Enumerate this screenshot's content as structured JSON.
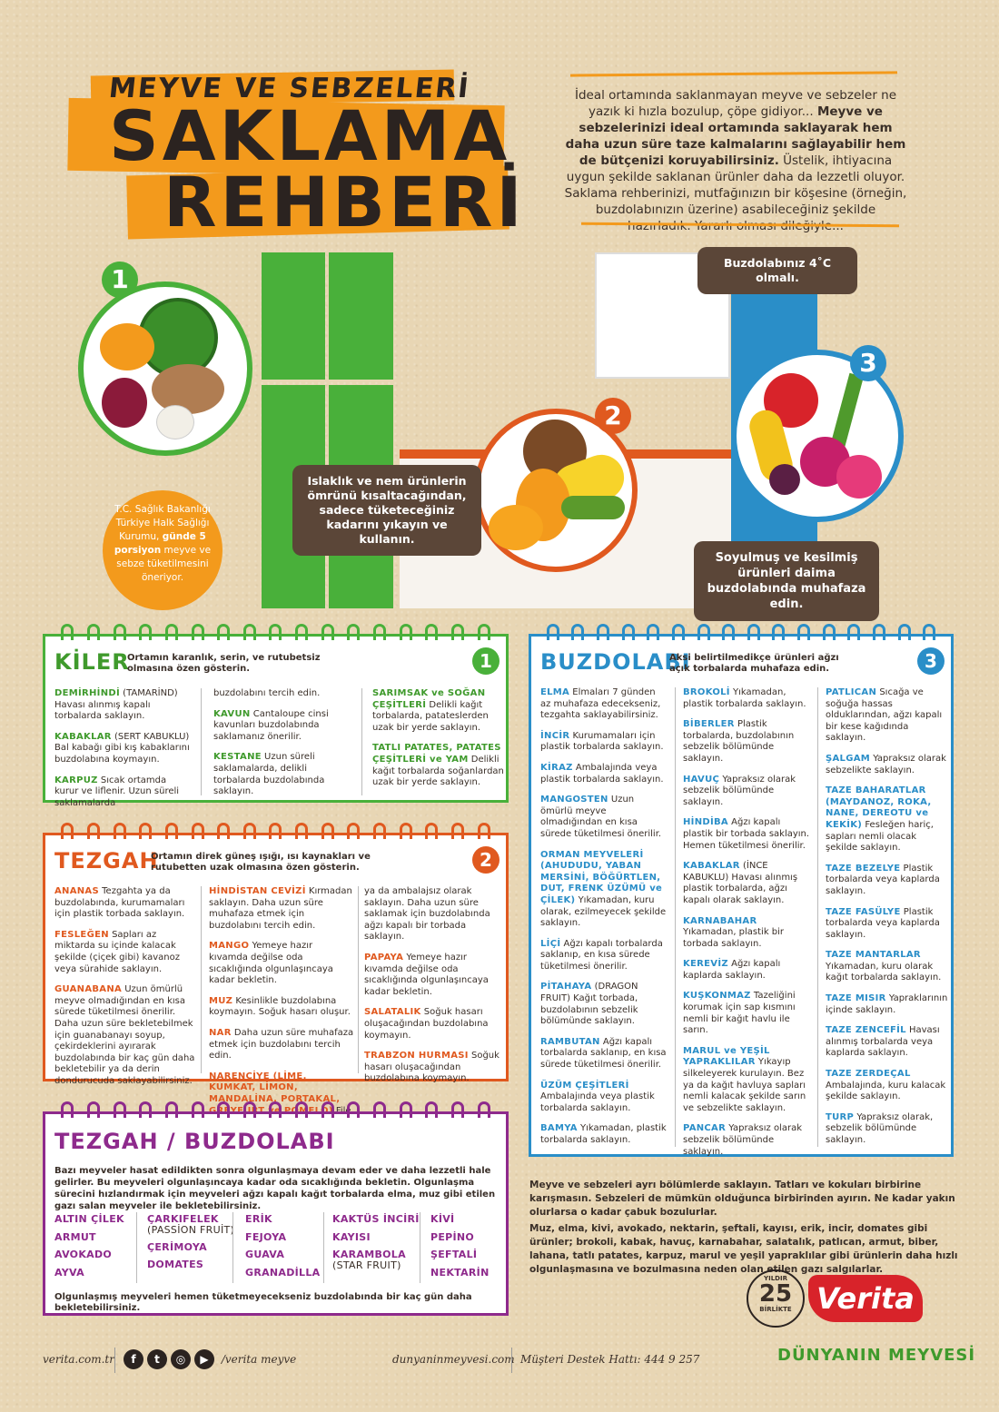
{
  "header": {
    "title_small": "MEYVE VE SEBZELERİ",
    "title_line1": "SAKLAMA",
    "title_line2": "REHBERİ",
    "intro_1": "İdeal ortamında saklanmayan meyve ve sebzeler ne yazık ki hızla bozulup, çöpe gidiyor...",
    "intro_bold": "Meyve ve sebzelerinizi ideal ortamında saklayarak hem daha uzun süre taze kalmalarını sağlayabilir hem de bütçenizi koruyabilirsiniz.",
    "intro_2": "Üstelik, ihtiyacına uygun şekilde saklanan ürünler daha da lezzetli oluyor. Saklama rehberinizi, mutfağınızın bir köşesine (örneğin, buzdolabınızın üzerine) asabileceğiniz şekilde hazırladık. Yararlı olması dileğiyle..."
  },
  "illustration": {
    "num1": "1",
    "num2": "2",
    "num3": "3",
    "fridge_temp": "Buzdolabınız 4˚C olmalı.",
    "wash_tip": "Islaklık ve nem ürünlerin ömrünü kısaltacağından, sadece tüketeceğiniz kadarını yıkayın ve kullanın.",
    "cut_tip": "Soyulmuş ve kesilmiş ürünleri daima buzdolabında muhafaza edin.",
    "health_1": "T.C. Sağlık Bakanlığı Türkiye Halk Sağlığı Kurumu,",
    "health_bold": "günde 5 porsiyon",
    "health_2": "meyve ve sebze tüketilmesini öneriyor."
  },
  "kiler": {
    "title": "KİLER",
    "subtitle": "Ortamın karanlık, serin, ve rutubetsiz olmasına özen gösterin.",
    "num": "1",
    "col1": [
      {
        "k": "DEMİRHİNDİ",
        "t": " (TAMARİND) Havası alınmış kapalı torbalarda saklayın."
      },
      {
        "k": "KABAKLAR",
        "t": " (SERT KABUKLU) Bal kabağı gibi kış kabaklarını buzdolabına koymayın."
      },
      {
        "k": "KARPUZ",
        "t": " Sıcak ortamda kurur ve liflenir. Uzun süreli saklamalarda"
      }
    ],
    "col2": [
      {
        "k": "",
        "t": "buzdolabını tercih edin."
      },
      {
        "k": "KAVUN",
        "t": " Cantaloupe cinsi kavunları buzdolabında saklamanız önerilir."
      },
      {
        "k": "KESTANE",
        "t": " Uzun süreli saklamalarda, delikli torbalarda buzdolabında saklayın."
      }
    ],
    "col3": [
      {
        "k": "SARIMSAK ve SOĞAN ÇEŞİTLERİ",
        "t": " Delikli kağıt torbalarda, patateslerden uzak bir yerde saklayın."
      },
      {
        "k": "TATLI PATATES, PATATES ÇEŞİTLERİ ve YAM",
        "t": " Delikli kağıt torbalarda soğanlardan uzak bir yerde saklayın."
      }
    ]
  },
  "tezgah": {
    "title": "TEZGAH",
    "subtitle": "Ortamın direk güneş ışığı, ısı kaynakları ve rutubetten uzak olmasına özen gösterin.",
    "num": "2",
    "col1": [
      {
        "k": "ANANAS",
        "t": " Tezgahta ya da buzdolabında, kurumamaları için plastik torbada saklayın."
      },
      {
        "k": "FESLEĞEN",
        "t": " Sapları az miktarda su içinde kalacak şekilde (çiçek gibi) kavanoz veya sürahide saklayın."
      },
      {
        "k": "GUANABANA",
        "t": " Uzun ömürlü meyve olmadığından en kısa sürede tüketilmesi önerilir. Daha uzun süre bekletebilmek için guanabanayı soyup, çekirdeklerini ayırarak buzdolabında bir kaç gün daha bekletebilir ya da derin dondurucuda saklayabilirsiniz."
      }
    ],
    "col2": [
      {
        "k": "HİNDİSTAN CEVİZİ",
        "t": " Kırmadan saklayın. Daha uzun süre muhafaza etmek için buzdolabını tercih edin."
      },
      {
        "k": "MANGO",
        "t": " Yemeye hazır kıvamda değilse oda sıcaklığında olgunlaşıncaya kadar bekletin."
      },
      {
        "k": "MUZ",
        "t": " Kesinlikle buzdolabına koymayın. Soğuk hasarı oluşur."
      },
      {
        "k": "NAR",
        "t": " Daha uzun süre muhafaza etmek için buzdolabını tercih edin."
      },
      {
        "k": "NARENCİYE (LİME, KUMKAT, LİMON, MANDALİNA, PORTAKAL, GREYFURT ve POMELO)",
        "t": " File içinde"
      }
    ],
    "col3": [
      {
        "k": "",
        "t": "ya da ambalajsız olarak saklayın. Daha uzun süre saklamak için buzdolabında ağzı kapalı bir torbada saklayın."
      },
      {
        "k": "PAPAYA",
        "t": " Yemeye hazır kıvamda değilse oda sıcaklığında olgunlaşıncaya kadar bekletin."
      },
      {
        "k": "SALATALIK",
        "t": " Soğuk hasarı oluşacağından buzdolabına koymayın."
      },
      {
        "k": "TRABZON HURMASI",
        "t": " Soğuk hasarı oluşacağından buzdolabına koymayın."
      }
    ]
  },
  "buzdolabi": {
    "title": "BUZDOLABI",
    "subtitle": "Aksi belirtilmedikçe ürünleri ağzı açık torbalarda muhafaza edin.",
    "num": "3",
    "col1": [
      {
        "k": "ELMA",
        "t": " Elmaları 7 günden az muhafaza edecekseniz, tezgahta saklayabilirsiniz."
      },
      {
        "k": "İNCİR",
        "t": " Kurumamaları için plastik torbalarda saklayın."
      },
      {
        "k": "KİRAZ",
        "t": " Ambalajında veya plastik torbalarda saklayın."
      },
      {
        "k": "MANGOSTEN",
        "t": " Uzun ömürlü meyve olmadığından en kısa sürede tüketilmesi önerilir."
      },
      {
        "k": "ORMAN MEYVELERİ (AHUDUDU, YABAN MERSİNİ, BÖĞÜRTLEN, DUT, FRENK ÜZÜMÜ ve ÇİLEK)",
        "t": " Yıkamadan, kuru olarak, ezilmeyecek şekilde saklayın."
      },
      {
        "k": "LİÇİ",
        "t": " Ağzı kapalı torbalarda saklanıp, en kısa sürede tüketilmesi önerilir."
      },
      {
        "k": "PİTAHAYA",
        "t": " (DRAGON FRUIT) Kağıt torbada, buzdolabının sebzelik bölümünde saklayın."
      },
      {
        "k": "RAMBUTAN",
        "t": " Ağzı kapalı torbalarda saklanıp, en kısa sürede tüketilmesi önerilir."
      },
      {
        "k": "ÜZÜM ÇEŞİTLERİ",
        "t": " Ambalajında veya plastik torbalarda saklayın."
      },
      {
        "k": "BAMYA",
        "t": " Yıkamadan, plastik torbalarda saklayın."
      }
    ],
    "col2": [
      {
        "k": "BROKOLİ",
        "t": " Yıkamadan, plastik torbalarda saklayın."
      },
      {
        "k": "BİBERLER",
        "t": " Plastik torbalarda, buzdolabının sebzelik bölümünde saklayın."
      },
      {
        "k": "HAVUÇ",
        "t": " Yapraksız olarak sebzelik bölümünde saklayın."
      },
      {
        "k": "HİNDİBA",
        "t": " Ağzı kapalı plastik bir torbada saklayın. Hemen tüketilmesi önerilir."
      },
      {
        "k": "KABAKLAR",
        "t": " (İNCE KABUKLU) Havası alınmış plastik torbalarda, ağzı kapalı olarak saklayın."
      },
      {
        "k": "KARNABAHAR",
        "t": " Yıkamadan, plastik bir torbada saklayın."
      },
      {
        "k": "KEREVİZ",
        "t": " Ağzı kapalı kaplarda saklayın."
      },
      {
        "k": "KUŞKONMAZ",
        "t": " Tazeliğini korumak için sap kısmını nemli bir kağıt havlu ile sarın."
      },
      {
        "k": "MARUL ve YEŞİL YAPRAKLILAR",
        "t": " Yıkayıp silkeleyerek kurulayın. Bez ya da kağıt havluya sapları nemli kalacak şekilde sarın ve sebzelikte saklayın."
      },
      {
        "k": "PANCAR",
        "t": " Yapraksız olarak sebzelik bölümünde saklayın."
      }
    ],
    "col3": [
      {
        "k": "PATLICAN",
        "t": " Sıcağa ve soğuğa hassas olduklarından, ağzı kapalı bir kese kağıdında saklayın."
      },
      {
        "k": "ŞALGAM",
        "t": " Yapraksız olarak sebzelikte saklayın."
      },
      {
        "k": "TAZE BAHARATLAR (MAYDANOZ, ROKA, NANE, DEREOTU ve KEKİK)",
        "t": " Fesleğen hariç, sapları nemli olacak şekilde saklayın."
      },
      {
        "k": "TAZE BEZELYE",
        "t": " Plastik torbalarda veya kaplarda saklayın."
      },
      {
        "k": "TAZE FASÜLYE",
        "t": " Plastik torbalarda veya kaplarda saklayın."
      },
      {
        "k": "TAZE MANTARLAR",
        "t": " Yıkamadan, kuru olarak kağıt torbalarda saklayın."
      },
      {
        "k": "TAZE MISIR",
        "t": " Yapraklarının içinde saklayın."
      },
      {
        "k": "TAZE ZENCEFİL",
        "t": " Havası alınmış torbalarda veya kaplarda saklayın."
      },
      {
        "k": "TAZE ZERDEÇAL",
        "t": " Ambalajında, kuru kalacak şekilde saklayın."
      },
      {
        "k": "TURP",
        "t": " Yapraksız olarak, sebzelik bölümünde saklayın."
      }
    ]
  },
  "tezgah_buzdolabi": {
    "title": "TEZGAH / BUZDOLABI",
    "intro": "Bazı meyveler hasat edildikten sonra olgunlaşmaya devam eder ve daha lezzetli hale gelirler. Bu meyveleri olgunlaşıncaya kadar oda sıcaklığında bekletin. Olgunlaşma sürecini hızlandırmak için meyveleri ağzı kapalı kağıt torbalarda elma, muz gibi etilen gazı salan meyveler ile bekletebilirsiniz.",
    "col1": [
      "ALTIN ÇİLEK",
      "ARMUT",
      "AVOKADO",
      "AYVA"
    ],
    "col2": [
      {
        "k": "ÇARKIFELEK",
        "n": "(PASSİON FRUİT)"
      },
      {
        "k": "ÇERİMOYA",
        "n": ""
      },
      {
        "k": "DOMATES",
        "n": ""
      }
    ],
    "col3": [
      "ERİK",
      "FEJOYA",
      "GUAVA",
      "GRANADİLLA"
    ],
    "col4": [
      {
        "k": "KAKTÜS İNCİRİ",
        "n": ""
      },
      {
        "k": "KAYISI",
        "n": ""
      },
      {
        "k": "KARAMBOLA",
        "n": "(STAR FRUIT)"
      }
    ],
    "col5": [
      "KİVİ",
      "PEPİNO",
      "ŞEFTALİ",
      "NEKTARİN"
    ],
    "outro": "Olgunlaşmış meyveleri hemen tüketmeyecekseniz buzdolabında bir kaç gün daha bekletebilirsiniz."
  },
  "notes": {
    "n1": "Meyve ve sebzeleri ayrı bölümlerde saklayın. Tatları ve kokuları birbirine karışmasın. Sebzeleri de mümkün olduğunca birbirinden ayırın. Ne kadar yakın olurlarsa o kadar çabuk bozulurlar.",
    "n2": "Muz, elma, kivi, avokado, nektarin, şeftali, kayısı, erik, incir, domates gibi ürünler; brokoli, kabak, havuç, karnabahar, salatalık, patlıcan, armut, biber, lahana, tatlı patates, karpuz, marul ve yeşil yapraklılar gibi ürünlerin daha hızlı olgunlaşmasına ve bozulmasına neden olan etilen gazı salgılarlar."
  },
  "brand": {
    "years": "25",
    "seal_top": "YILDIR",
    "seal_bottom": "BİRLİKTE",
    "name": "Verita",
    "tagline": "DÜNYANIN MEYVESİ"
  },
  "footer": {
    "site": "verita.com.tr",
    "social": "/verita meyve",
    "site2": "dunyaninmeyvesi.com",
    "hotline": "Müşteri Destek Hattı: 444 9 257"
  },
  "colors": {
    "orange": "#f39a1c",
    "green": "#3f9a2c",
    "tezgah": "#e0591f",
    "blue": "#2a8ec8",
    "purple": "#8e2a8c",
    "brown": "#5b4638",
    "verita_red": "#d8232a"
  }
}
